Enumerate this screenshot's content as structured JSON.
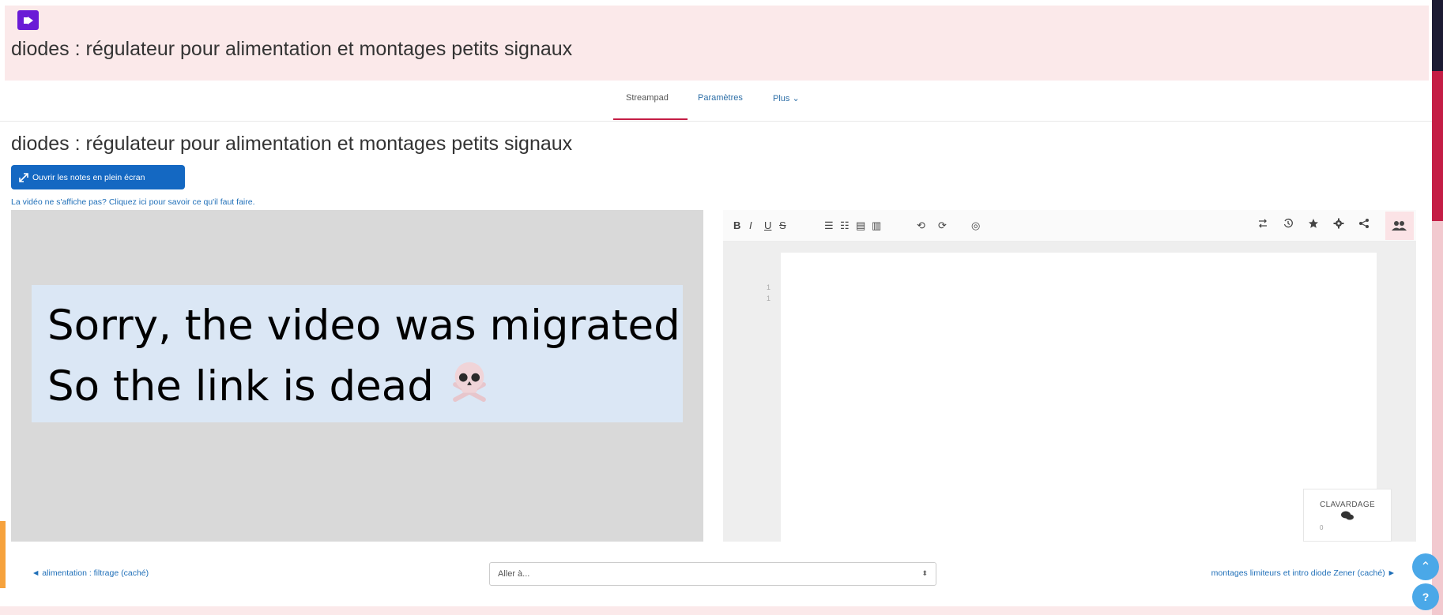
{
  "header": {
    "plugin_icon": "play-arrow-icon",
    "course_title": "diodes : régulateur pour alimentation et montages petits signaux"
  },
  "tabs": {
    "active": "Streampad",
    "params": "Paramètres",
    "more": "Plus ⌄"
  },
  "main": {
    "title": "diodes : régulateur pour alimentation et montages petits signaux",
    "fullscreen_button": "Ouvrir les notes en plein écran",
    "fullscreen_icon": "expand-arrows-icon",
    "help_link": "La vidéo ne s'affiche pas? Cliquez ici pour savoir ce qu'il faut faire."
  },
  "video": {
    "message_line1": "Sorry, the video was migrated",
    "message_line2": "So the link is dead",
    "emoji_icon": "skull-crossbones-icon"
  },
  "editor": {
    "toolbar": {
      "bold": "B",
      "italic": "I",
      "underline": "U",
      "strike": "S",
      "list_bullets": "☰",
      "list_numbers": "☷",
      "indent": "▤",
      "outdent": "▥",
      "undo": "⟲",
      "redo": "⟳",
      "hide": "◎",
      "icons_right": [
        "swap-icon",
        "history-icon",
        "star-icon",
        "gear-icon",
        "share-icon",
        "users-icon"
      ]
    },
    "line_numbers": [
      "1",
      "1"
    ],
    "chat": {
      "label": "CLAVARDAGE",
      "count": "0"
    }
  },
  "footer_nav": {
    "prev": "◄ alimentation : filtrage (caché)",
    "select_value": "Aller à...",
    "next": "montages limiteurs et intro diode Zener (caché) ►"
  },
  "floating": {
    "scroll_top": "⌃",
    "help": "?"
  },
  "colors": {
    "accent_red": "#c41d45",
    "button_blue": "#1468c2",
    "link_blue": "#1f6fb8",
    "header_pink": "#fbe9ea",
    "message_bg": "#dbe7f5",
    "float_blue": "#4aa8e8"
  }
}
